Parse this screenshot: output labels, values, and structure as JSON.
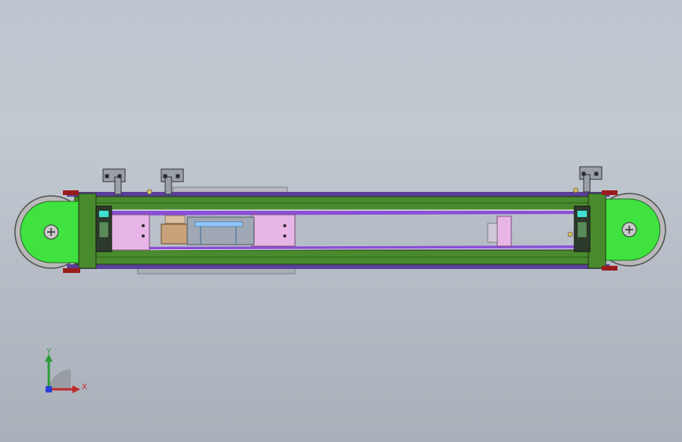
{
  "viewport": {
    "model": "belt-conveyor-assembly",
    "colors": {
      "background_top": "#c3c9d1",
      "frame_green": "#4a8a2e",
      "pulley_green": "#3fe23f",
      "belt_purple": "#8a4fd6",
      "bracket_pink": "#e8b6e6",
      "motor_tan": "#c9a27a",
      "pulley_grey": "#b9b9b9"
    }
  },
  "triad": {
    "x_label": "X",
    "y_label": "Y"
  }
}
